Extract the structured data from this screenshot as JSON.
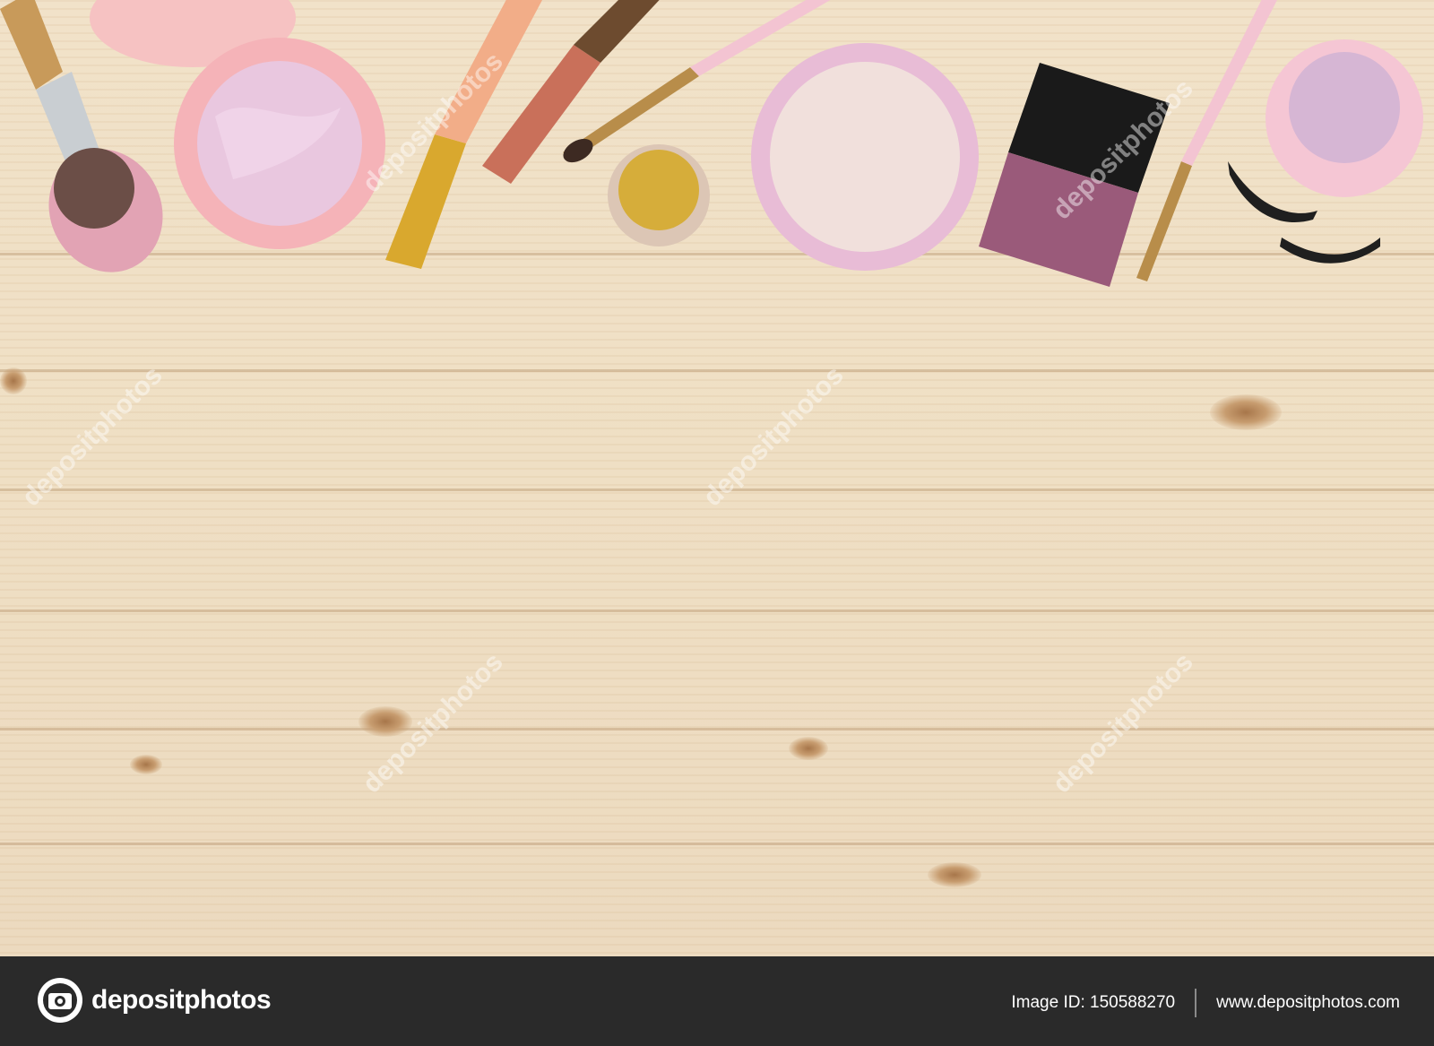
{
  "photo": {
    "watermark_text": "depositphotos",
    "colors": {
      "wood": "#efdfc4",
      "footer_bg": "#2a2a2a",
      "footer_text": "#ffffff",
      "blush_case": "#f5b3b8",
      "powder_case": "#e8bcd6",
      "lipstick": "#c9705a",
      "gold": "#d6ad3a"
    }
  },
  "footer": {
    "logo_text": "depositphotos",
    "image_id_label": "Image ID: 150588270",
    "site_url": "www.depositphotos.com"
  }
}
